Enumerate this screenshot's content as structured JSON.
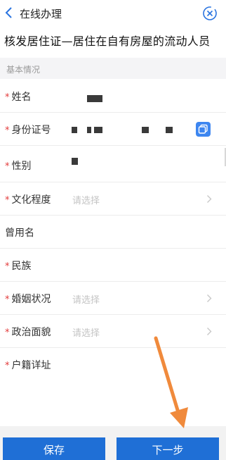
{
  "nav": {
    "title": "在线办理"
  },
  "page_title": "核发居住证—居住在自有房屋的流动人员",
  "section": {
    "title": "基本情况"
  },
  "fields": [
    {
      "label": "姓名",
      "required": true
    },
    {
      "label": "身份证号",
      "required": true
    },
    {
      "label": "性别",
      "required": true
    },
    {
      "label": "文化程度",
      "required": true,
      "placeholder": "请选择"
    },
    {
      "label": "曾用名",
      "required": false
    },
    {
      "label": "民族",
      "required": true
    },
    {
      "label": "婚姻状况",
      "required": true,
      "placeholder": "请选择"
    },
    {
      "label": "政治面貌",
      "required": true,
      "placeholder": "请选择"
    },
    {
      "label": "户籍详址",
      "required": true
    }
  ],
  "footer": {
    "save_label": "保存",
    "next_label": "下一步"
  },
  "colors": {
    "primary": "#1f6fd6",
    "required": "#e23a3a",
    "arrow": "#f08a3c"
  }
}
